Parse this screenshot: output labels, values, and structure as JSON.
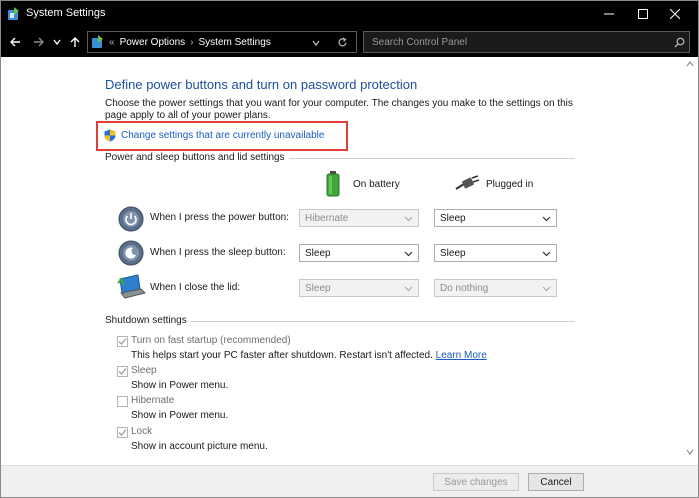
{
  "window": {
    "title": "System Settings",
    "controls": {
      "minimize": "minimize-icon",
      "maximize": "maximize-icon",
      "close": "close-icon"
    }
  },
  "nav": {
    "breadcrumb_prefix": "«",
    "breadcrumb": [
      "Power Options",
      "System Settings"
    ],
    "separator": "›",
    "search_placeholder": "Search Control Panel"
  },
  "main": {
    "heading": "Define power buttons and turn on password protection",
    "description": "Choose the power settings that you want for your computer. The changes you make to the settings on this page apply to all of your power plans.",
    "change_link": "Change settings that are currently unavailable",
    "section_power": "Power and sleep buttons and lid settings",
    "col_battery": "On battery",
    "col_plugged": "Plugged in",
    "rows": [
      {
        "label": "When I press the power button:",
        "battery": "Hibernate",
        "plugged": "Sleep",
        "battery_disabled": true,
        "plugged_disabled": false
      },
      {
        "label": "When I press the sleep button:",
        "battery": "Sleep",
        "plugged": "Sleep",
        "battery_disabled": false,
        "plugged_disabled": false
      },
      {
        "label": "When I close the lid:",
        "battery": "Sleep",
        "plugged": "Do nothing",
        "battery_disabled": true,
        "plugged_disabled": true
      }
    ],
    "section_shutdown": "Shutdown settings",
    "shutdown": [
      {
        "label": "Turn on fast startup (recommended)",
        "desc": "This helps start your PC faster after shutdown. Restart isn't affected.",
        "link": "Learn More",
        "checked": true
      },
      {
        "label": "Sleep",
        "desc": "Show in Power menu.",
        "checked": true
      },
      {
        "label": "Hibernate",
        "desc": "Show in Power menu.",
        "checked": false
      },
      {
        "label": "Lock",
        "desc": "Show in account picture menu.",
        "checked": true
      }
    ]
  },
  "footer": {
    "save": "Save changes",
    "cancel": "Cancel"
  },
  "colors": {
    "link": "#1a5dbf",
    "heading": "#1e4e9e",
    "highlight": "#e0403a",
    "titlebar": "#000000"
  }
}
